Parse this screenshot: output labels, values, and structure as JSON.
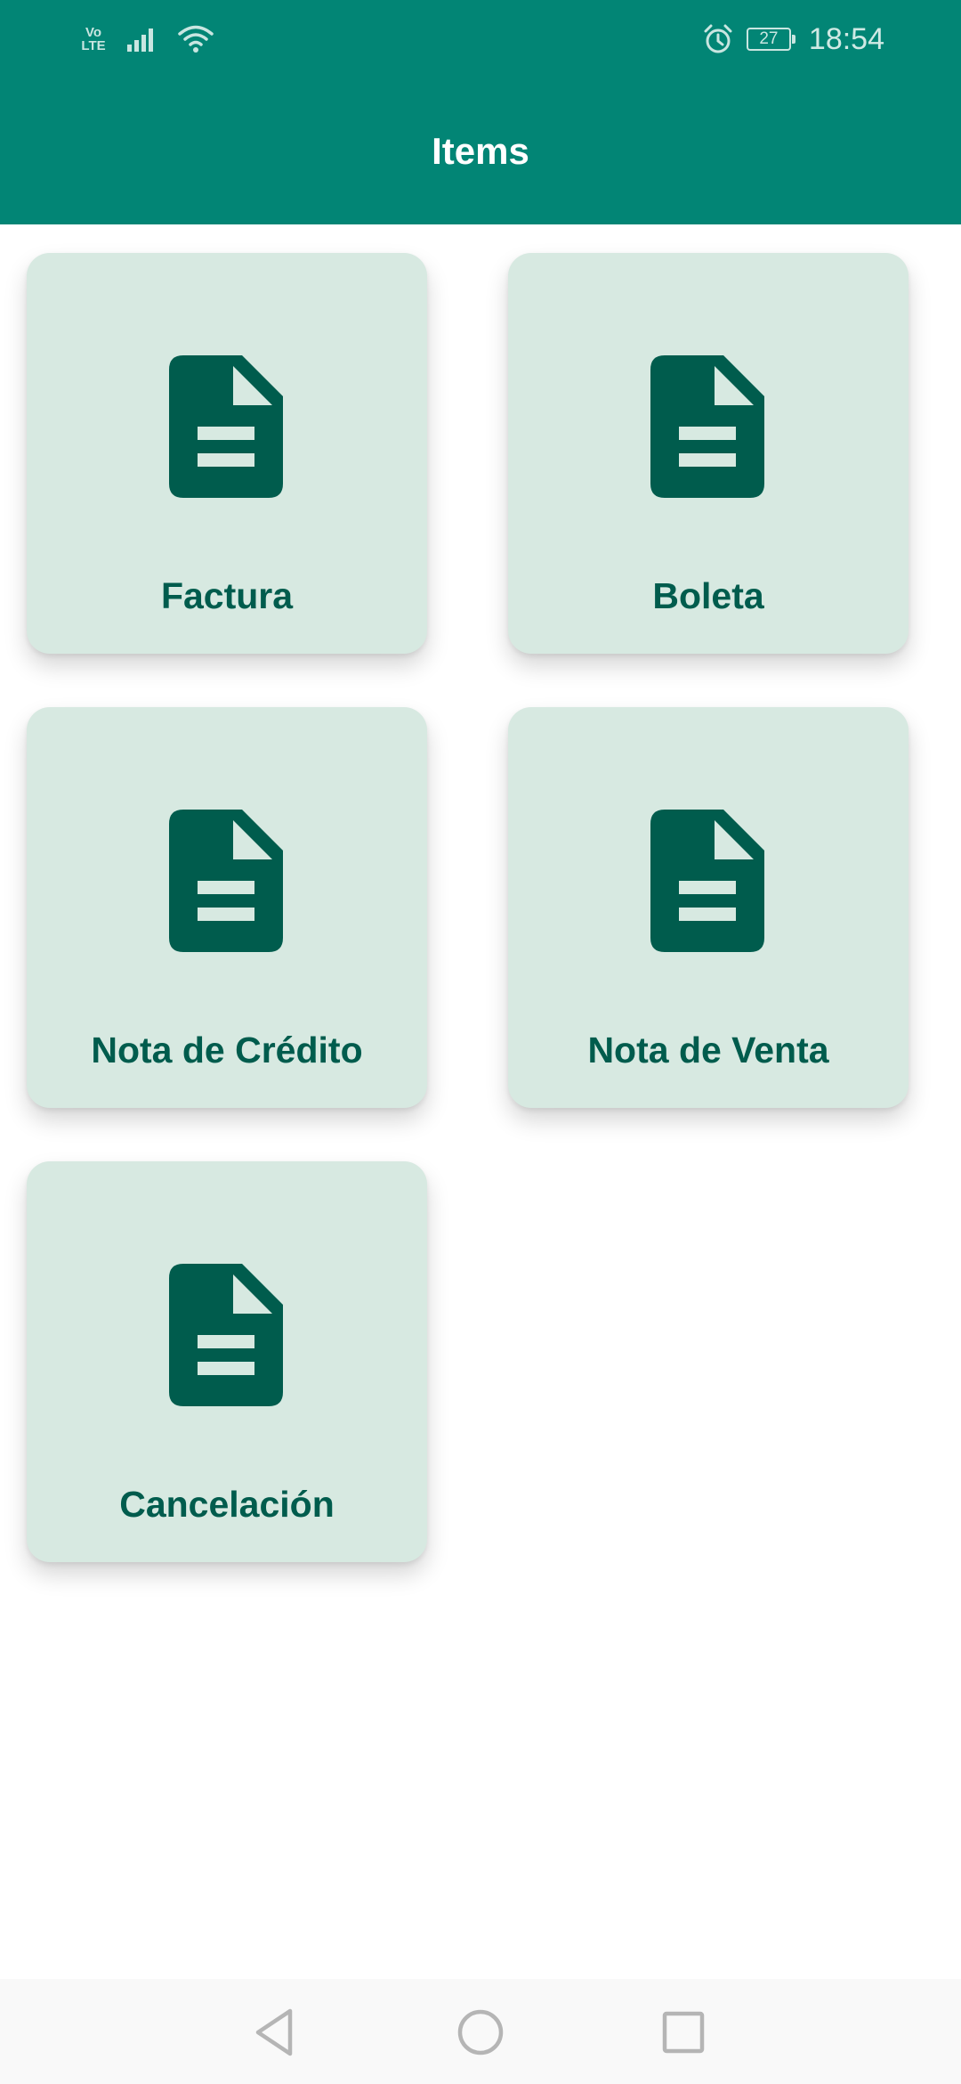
{
  "status_bar": {
    "network_line1": "Vo",
    "network_line2": "LTE",
    "battery_level": "27",
    "time": "18:54",
    "icons": [
      "volte-icon",
      "signal-icon",
      "wifi-icon",
      "alarm-icon",
      "battery-icon"
    ]
  },
  "app_bar": {
    "title": "Items"
  },
  "items": [
    {
      "label": "Factura",
      "icon": "document-icon"
    },
    {
      "label": "Boleta",
      "icon": "document-icon"
    },
    {
      "label": "Nota de Crédito",
      "icon": "document-icon"
    },
    {
      "label": "Nota de Venta",
      "icon": "document-icon"
    },
    {
      "label": "Cancelación",
      "icon": "document-icon"
    }
  ],
  "navigation_bar": {
    "icons": [
      "back-icon",
      "home-icon",
      "recents-icon"
    ]
  },
  "colors": {
    "primary": "#028575",
    "card_background": "#d7e9e1",
    "icon_and_label": "#005c4d",
    "status_text": "#cfe9e4",
    "nav_background": "#f9f9f9"
  }
}
